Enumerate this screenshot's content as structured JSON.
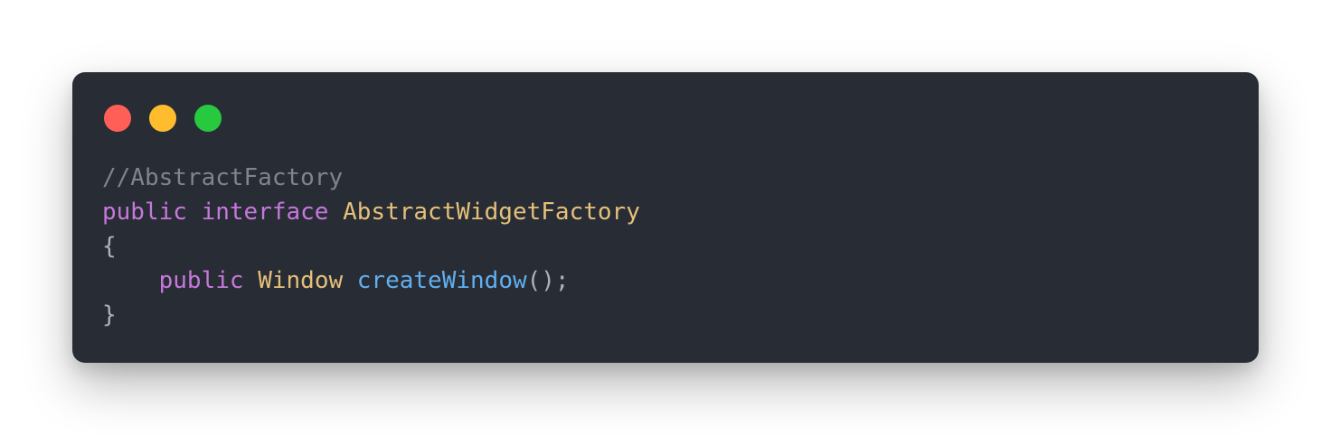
{
  "window": {
    "controls": [
      {
        "name": "close",
        "color": "#ff5f56"
      },
      {
        "name": "minimize",
        "color": "#ffbd2e"
      },
      {
        "name": "maximize",
        "color": "#27c93f"
      }
    ]
  },
  "code": {
    "lines": [
      [
        {
          "type": "comment",
          "text": "//AbstractFactory"
        }
      ],
      [
        {
          "type": "keyword",
          "text": "public"
        },
        {
          "type": "plain",
          "text": " "
        },
        {
          "type": "keyword",
          "text": "interface"
        },
        {
          "type": "plain",
          "text": " "
        },
        {
          "type": "type",
          "text": "AbstractWidgetFactory"
        }
      ],
      [
        {
          "type": "punct",
          "text": "{"
        }
      ],
      [
        {
          "type": "plain",
          "text": "    "
        },
        {
          "type": "keyword",
          "text": "public"
        },
        {
          "type": "plain",
          "text": " "
        },
        {
          "type": "type",
          "text": "Window"
        },
        {
          "type": "plain",
          "text": " "
        },
        {
          "type": "func",
          "text": "createWindow"
        },
        {
          "type": "punct",
          "text": "();"
        }
      ],
      [
        {
          "type": "punct",
          "text": "}"
        }
      ]
    ]
  }
}
